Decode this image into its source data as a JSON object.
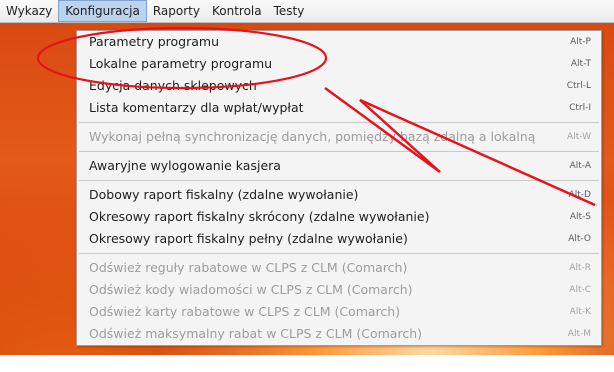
{
  "menubar": {
    "items": [
      {
        "label": "Wykazy",
        "active": false
      },
      {
        "label": "Konfiguracja",
        "active": true
      },
      {
        "label": "Raporty",
        "active": false
      },
      {
        "label": "Kontrola",
        "active": false
      },
      {
        "label": "Testy",
        "active": false
      }
    ]
  },
  "menu": {
    "groups": [
      [
        {
          "label": "Parametry programu",
          "shortcut": "Alt-P",
          "enabled": true
        },
        {
          "label": "Lokalne parametry programu",
          "shortcut": "Alt-T",
          "enabled": true
        },
        {
          "label": "Edycja danych sklepowych",
          "shortcut": "Ctrl-L",
          "enabled": true
        },
        {
          "label": "Lista komentarzy dla wpłat/wypłat",
          "shortcut": "Ctrl-I",
          "enabled": true
        }
      ],
      [
        {
          "label": "Wykonaj pełną synchronizację danych, pomiędzy bazą zdalną a lokalną",
          "shortcut": "Alt-W",
          "enabled": false
        }
      ],
      [
        {
          "label": "Awaryjne wylogowanie kasjera",
          "shortcut": "Alt-A",
          "enabled": true
        }
      ],
      [
        {
          "label": "Dobowy raport fiskalny (zdalne wywołanie)",
          "shortcut": "Alt-D",
          "enabled": true
        },
        {
          "label": "Okresowy raport fiskalny skrócony (zdalne wywołanie)",
          "shortcut": "Alt-S",
          "enabled": true
        },
        {
          "label": "Okresowy raport fiskalny pełny (zdalne wywołanie)",
          "shortcut": "Alt-O",
          "enabled": true
        }
      ],
      [
        {
          "label": "Odśwież reguły rabatowe w CLPS z CLM (Comarch)",
          "shortcut": "Alt-R",
          "enabled": false
        },
        {
          "label": "Odśwież kody wiadomości w CLPS z CLM (Comarch)",
          "shortcut": "Alt-C",
          "enabled": false
        },
        {
          "label": "Odśwież karty rabatowe w CLPS z CLM (Comarch)",
          "shortcut": "Alt-K",
          "enabled": false
        },
        {
          "label": "Odśwież maksymalny rabat w CLPS z CLM (Comarch)",
          "shortcut": "Alt-M",
          "enabled": false
        }
      ]
    ]
  },
  "annotation": {
    "color": "#e8101a"
  }
}
